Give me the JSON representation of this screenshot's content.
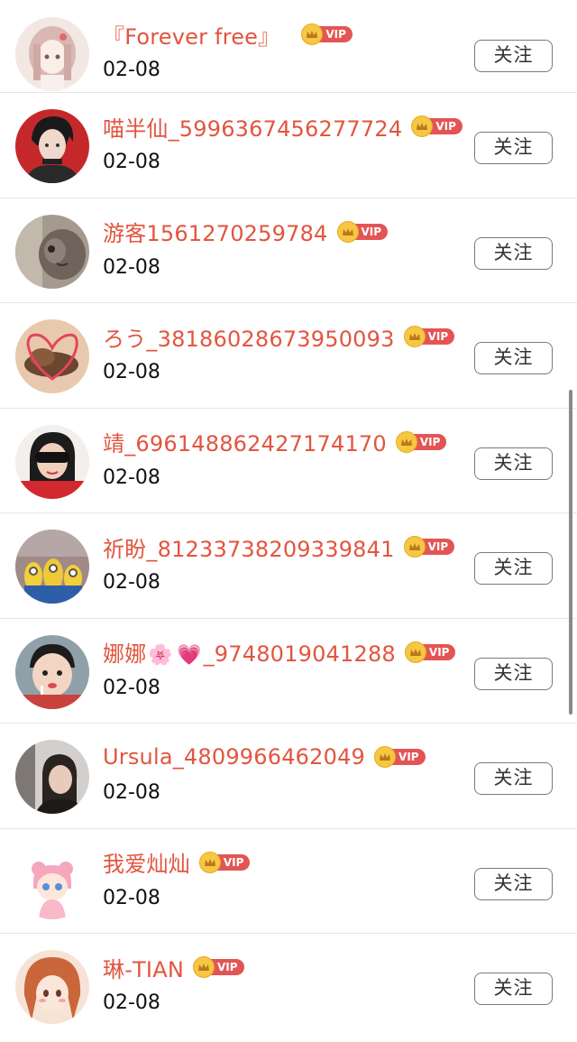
{
  "rows": [
    {
      "name": "『Forever free』",
      "date": "02-08",
      "button": "关注",
      "vip": "VIP",
      "avatar": "girl-illustration-avatar",
      "name_top": 1
    },
    {
      "name": "喵半仙_5996367456277724",
      "date": "02-08",
      "button": "关注",
      "vip": "VIP",
      "avatar": "anime-man-avatar"
    },
    {
      "name": "游客1561270259784",
      "date": "02-08",
      "button": "关注",
      "vip": "VIP",
      "avatar": "cat-photo-avatar"
    },
    {
      "name": "ろう_38186028673950093",
      "date": "02-08",
      "button": "关注",
      "vip": "VIP",
      "avatar": "hair-heart-avatar"
    },
    {
      "name": "靖_696148862427174170",
      "date": "02-08",
      "button": "关注",
      "vip": "VIP",
      "avatar": "sunglasses-woman-avatar"
    },
    {
      "name": "祈盼_81233738209339841",
      "date": "02-08",
      "button": "关注",
      "vip": "VIP",
      "avatar": "minions-avatar"
    },
    {
      "name_prefix": "娜娜",
      "name_emoji1": "🌸",
      "name_emoji2": "💗",
      "name_suffix": "_9748019041288",
      "date": "02-08",
      "button": "关注",
      "vip": "VIP",
      "avatar": "child-photo-avatar"
    },
    {
      "name": "Ursula_4809966462049",
      "date": "02-08",
      "button": "关注",
      "vip": "VIP",
      "avatar": "woman-photo-avatar"
    },
    {
      "name": "我爱灿灿",
      "date": "02-08",
      "button": "关注",
      "vip": "VIP",
      "avatar": "cartoon-bear-avatar"
    },
    {
      "name": "琳-TIAN",
      "date": "02-08",
      "button": "关注",
      "vip": "VIP",
      "avatar": "anime-girl-avatar"
    }
  ],
  "colors": {
    "name": "#e2553f",
    "vip_pill": "#e35555",
    "crown": "#f6c743"
  }
}
